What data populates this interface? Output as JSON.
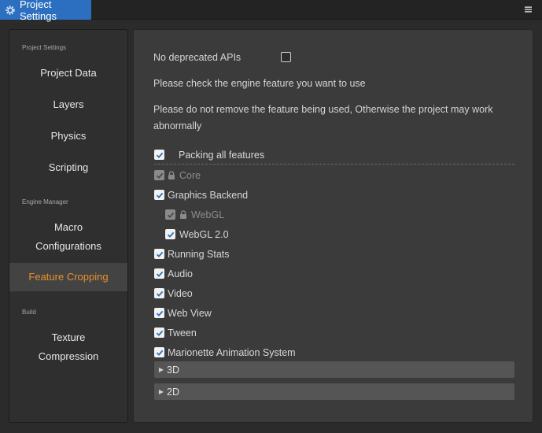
{
  "window": {
    "tab_title": "Project Settings",
    "menu_icon": "hamburger-menu-icon"
  },
  "sidebar": {
    "groups": [
      {
        "label": "Project Settings"
      },
      {
        "label": "Engine Manager"
      },
      {
        "label": "Build"
      }
    ],
    "items": [
      {
        "label": "Project Data"
      },
      {
        "label": "Layers"
      },
      {
        "label": "Physics"
      },
      {
        "label": "Scripting"
      },
      {
        "label": "Macro"
      },
      {
        "label": "Configurations"
      },
      {
        "label": "Feature Cropping"
      },
      {
        "label": "Texture"
      },
      {
        "label": "Compression"
      }
    ],
    "active_color": "#e8902a"
  },
  "main": {
    "no_deprecated_label": "No deprecated APIs",
    "no_deprecated_checked": false,
    "hint1": "Please check the engine feature you want to use",
    "hint2_line1": "Please do not remove the feature being used, Otherwise the project may work",
    "hint2_line2": "abnormally",
    "packing_label": "Packing all features",
    "features": [
      {
        "label": "Core",
        "checked": true,
        "locked": true
      },
      {
        "label": "Graphics Backend",
        "checked": true
      },
      {
        "label": "WebGL",
        "checked": true,
        "locked": true
      },
      {
        "label": "WebGL 2.0",
        "checked": true
      },
      {
        "label": "Running Stats",
        "checked": true
      },
      {
        "label": "Audio",
        "checked": true
      },
      {
        "label": "Video",
        "checked": true
      },
      {
        "label": "Web View",
        "checked": true
      },
      {
        "label": "Tween",
        "checked": true
      },
      {
        "label": "Marionette Animation System",
        "checked": true
      }
    ],
    "sections": [
      {
        "label": "3D"
      },
      {
        "label": "2D"
      }
    ]
  }
}
